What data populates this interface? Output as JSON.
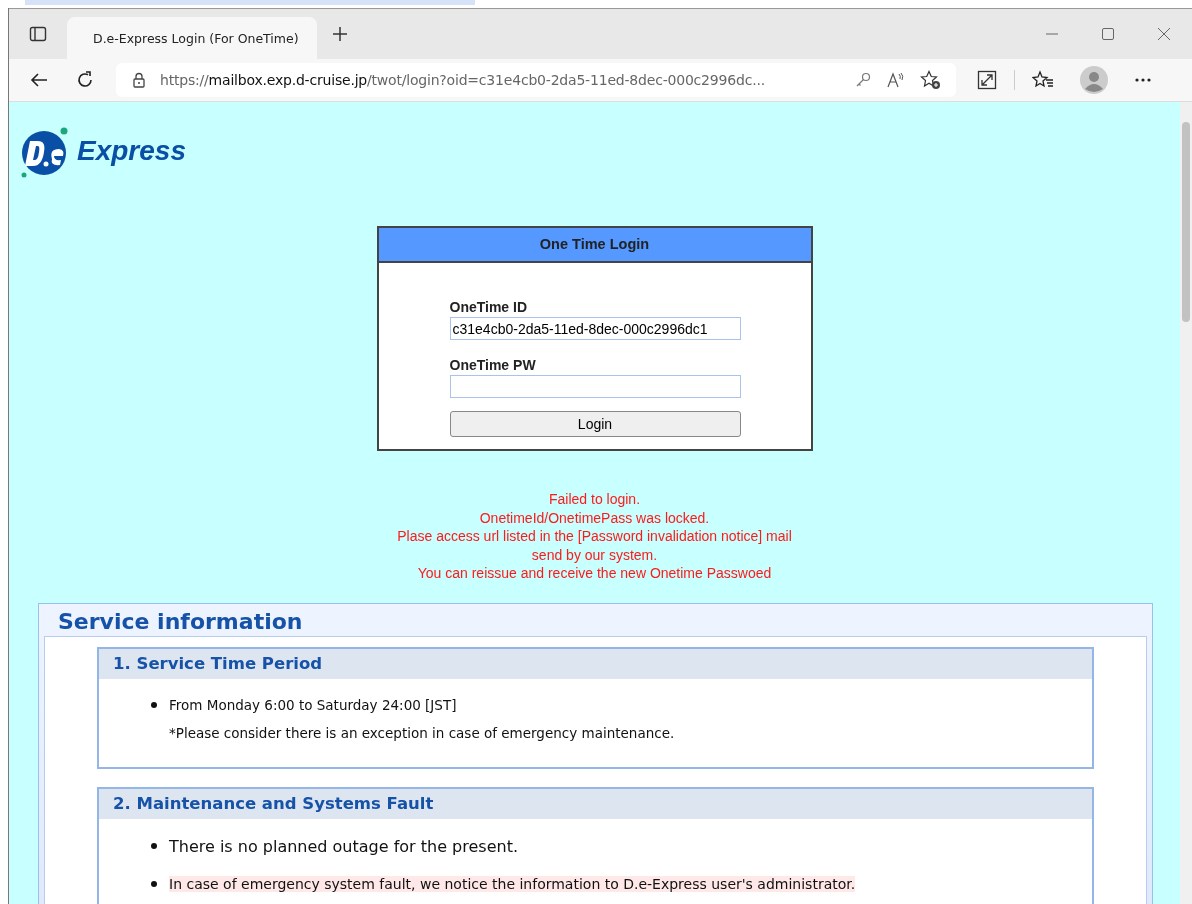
{
  "browser": {
    "tab_title": "D.e-Express Login (For OneTime)",
    "url_prefix": "https://",
    "url_host": "mailbox.exp.d-cruise.jp",
    "url_rest": "/twot/login?oid=c31e4cb0-2da5-11ed-8dec-000c2996dc..."
  },
  "logo": {
    "text": "Express"
  },
  "login": {
    "title": "One Time Login",
    "id_label": "OneTime ID",
    "id_value": "c31e4cb0-2da5-11ed-8dec-000c2996dc1",
    "pw_label": "OneTime PW",
    "button": "Login"
  },
  "error_lines": [
    "Failed to login.",
    "OnetimeId/OnetimePass was locked.",
    "Plase access url listed in the [Password invalidation notice] mail",
    "send by our system.",
    "You can reissue and receive the new Onetime Passwoed"
  ],
  "service": {
    "title": "Service information",
    "sections": [
      {
        "title": "1. Service Time Period",
        "items": [
          {
            "kind": "bullet",
            "text": "From Monday 6:00 to Saturday 24:00 [JST]"
          },
          {
            "kind": "note",
            "text": "*Please consider there is an exception in case of emergency maintenance."
          }
        ]
      },
      {
        "title": "2. Maintenance and Systems Fault",
        "items": [
          {
            "kind": "bullet-large",
            "text": "There is no planned outage for the present."
          },
          {
            "kind": "highlight",
            "text": "In case of emergency system fault, we notice the information to D.e-Express user's administrator."
          }
        ]
      }
    ]
  }
}
